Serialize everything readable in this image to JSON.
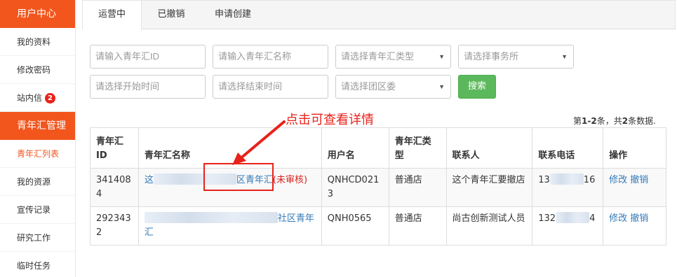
{
  "sidebar": {
    "section1": "用户中心",
    "items1": [
      {
        "label": "我的资料"
      },
      {
        "label": "修改密码"
      },
      {
        "label": "站内信",
        "badge": "2"
      }
    ],
    "section2": "青年汇管理",
    "items2": [
      {
        "label": "青年汇列表"
      },
      {
        "label": "我的资源"
      },
      {
        "label": "宣传记录"
      },
      {
        "label": "研究工作"
      },
      {
        "label": "临时任务"
      }
    ]
  },
  "tabs": [
    "运营中",
    "已撤销",
    "申请创建"
  ],
  "filters": {
    "id_placeholder": "请输入青年汇ID",
    "name_placeholder": "请输入青年汇名称",
    "type_placeholder": "请选择青年汇类型",
    "office_placeholder": "请选择事务所",
    "start_placeholder": "请选择开始时间",
    "end_placeholder": "请选择结束时间",
    "district_placeholder": "请选择团区委",
    "search_label": "搜索"
  },
  "summary": {
    "prefix": "第",
    "range": "1-2",
    "mid": "条，共",
    "total": "2",
    "suffix": "条数据."
  },
  "annotation": "点击可查看详情",
  "table": {
    "headers": [
      "青年汇ID",
      "青年汇名称",
      "用户名",
      "青年汇类型",
      "联系人",
      "联系电话",
      "操作"
    ],
    "rows": [
      {
        "id": "3414084",
        "name_prefix": "这",
        "name_suffix": "区青年汇",
        "status": "(未审核)",
        "username": "QNHCD0213",
        "type": "普通店",
        "contact": "这个青年汇要撤店",
        "phone_start": "13",
        "phone_end": "16",
        "edit": "修改",
        "revoke": "撤销"
      },
      {
        "id": "2923432",
        "name_visible": "社区青年汇",
        "username": "QNH0565",
        "type": "普通店",
        "contact": "尚古创新测试人员",
        "phone_start": "132",
        "phone_end": "4",
        "edit": "修改",
        "revoke": "撤销"
      }
    ]
  },
  "colors": {
    "accent": "#f2561d",
    "link": "#337ab7",
    "success": "#5cb85c",
    "alert": "#e8221b"
  }
}
